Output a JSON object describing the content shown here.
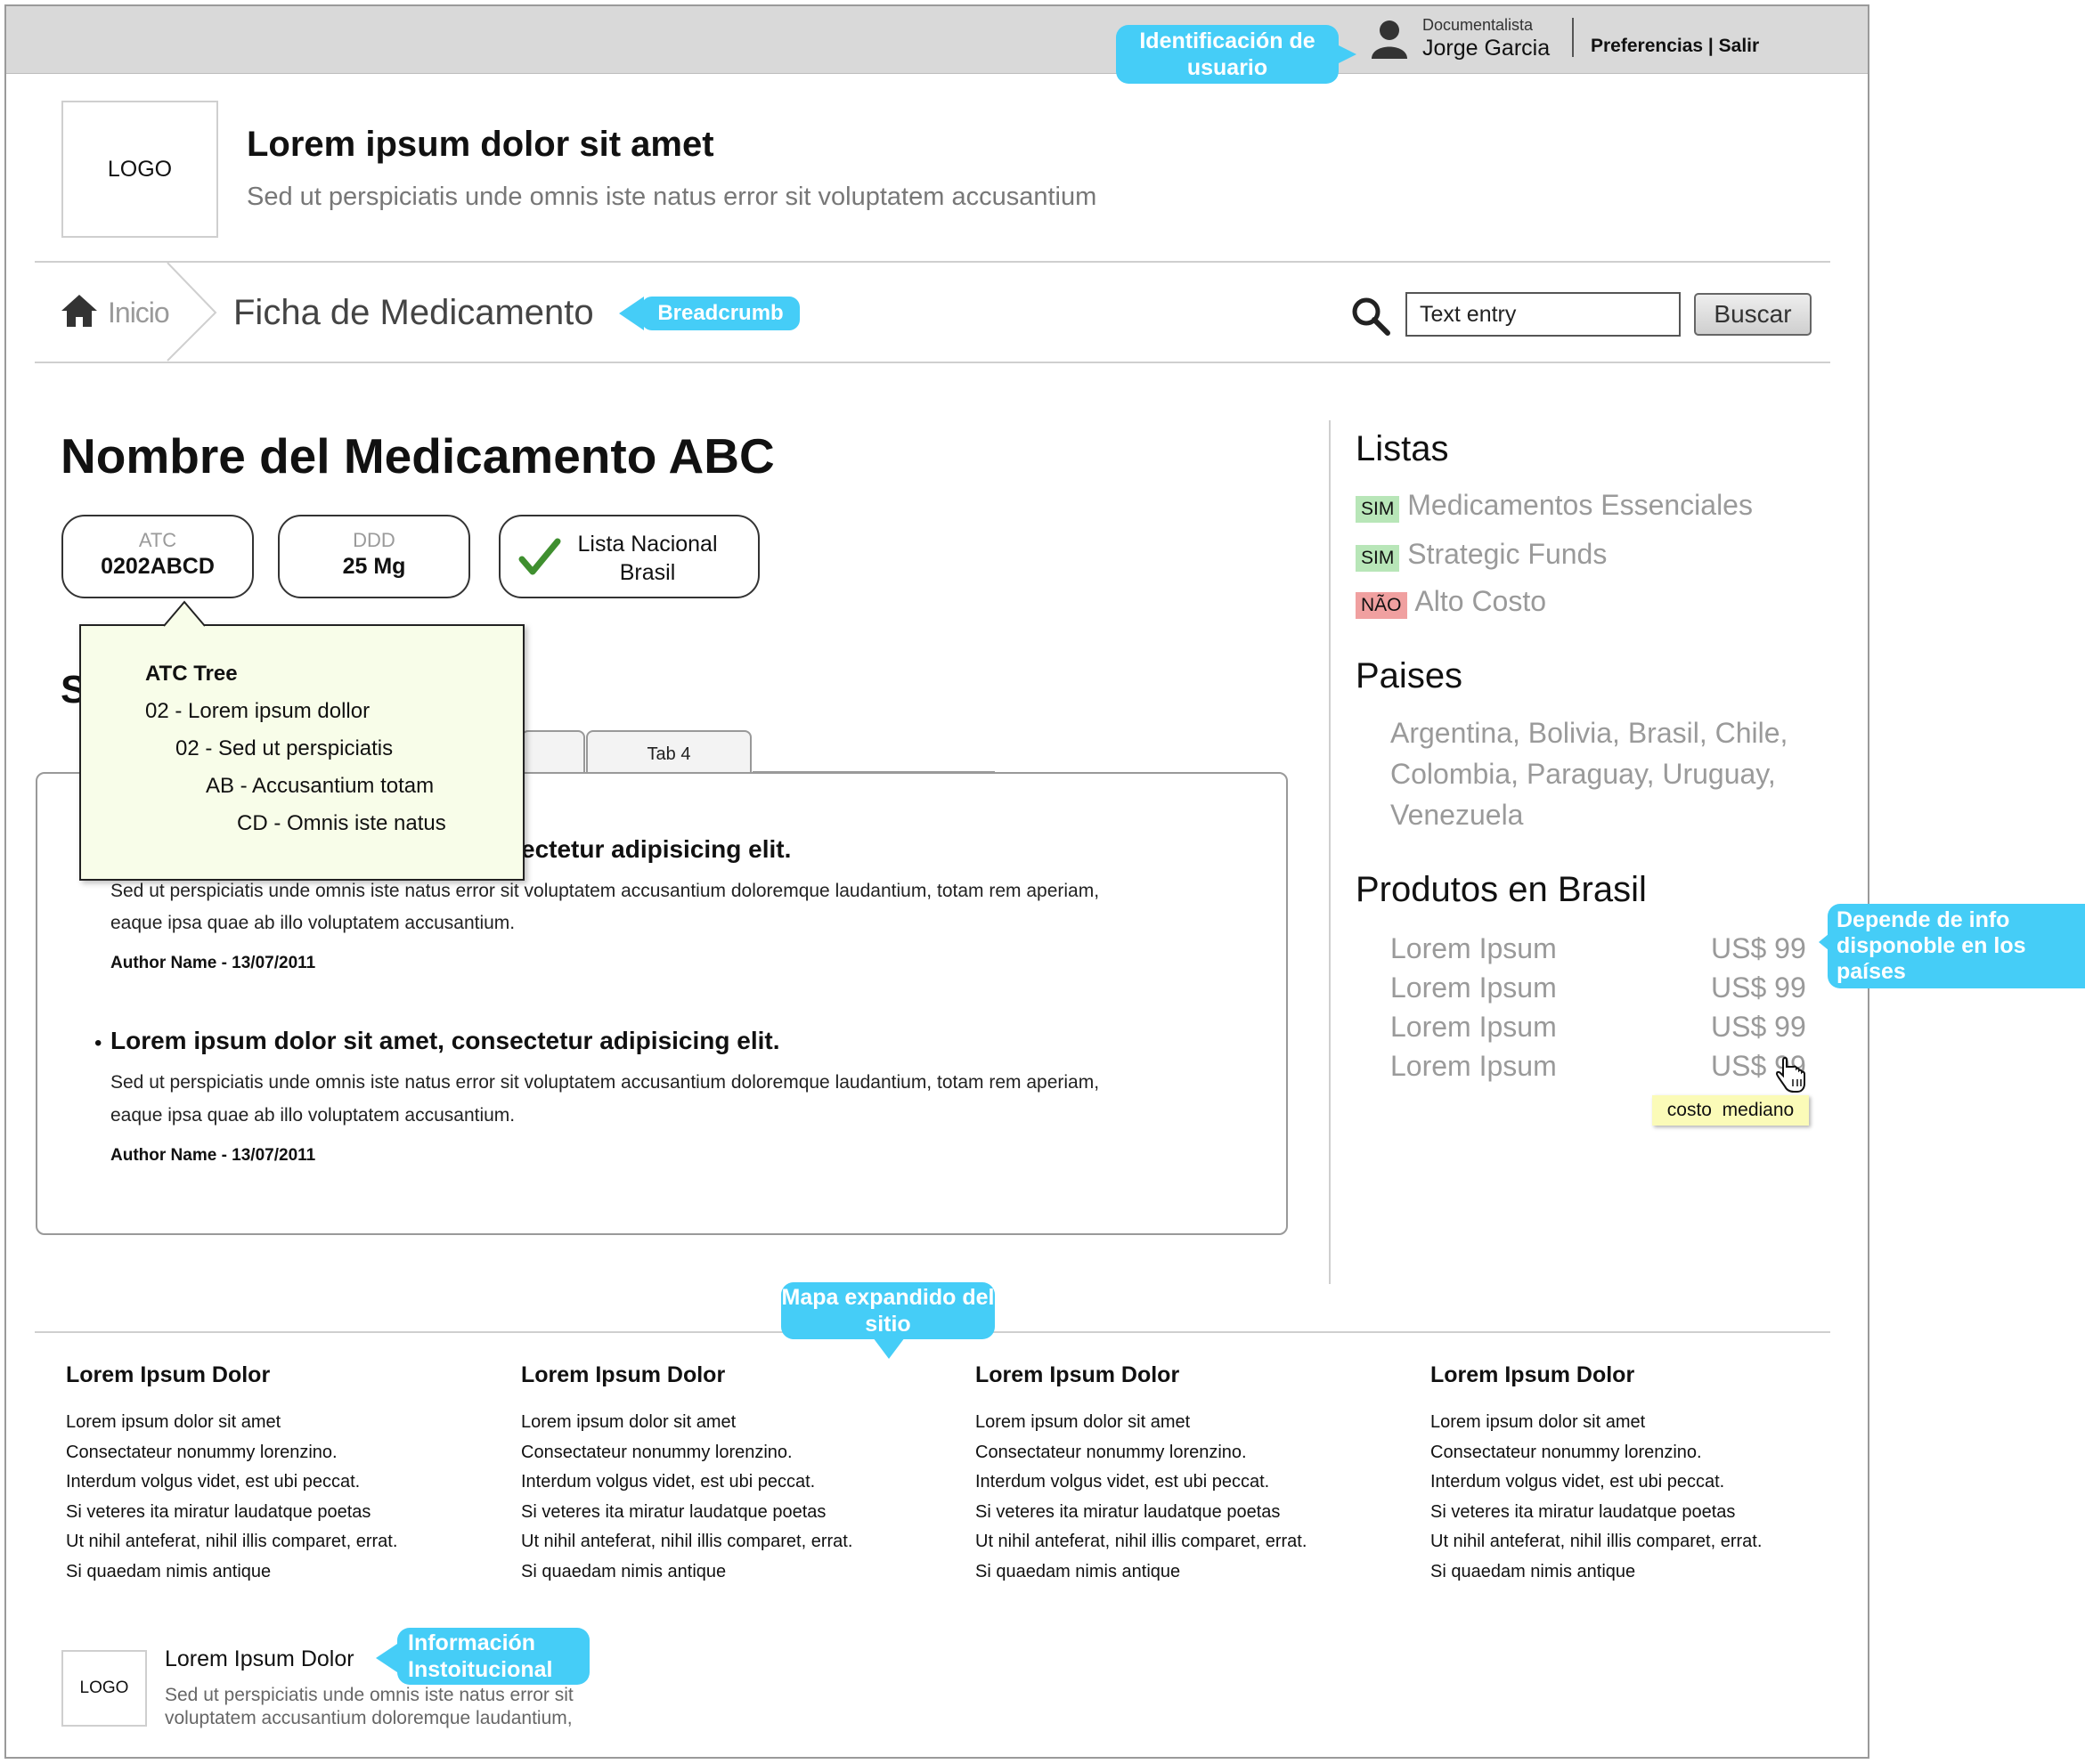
{
  "user": {
    "callout": "Identificación de usuario",
    "role": "Documentalista",
    "name": "Jorge Garcia",
    "links": "Preferencias | Salir"
  },
  "header": {
    "logo": "LOGO",
    "title": "Lorem ipsum dolor sit amet",
    "subtitle": "Sed ut perspiciatis unde omnis iste natus error sit voluptatem accusantium"
  },
  "nav": {
    "home": "Inicio",
    "current": "Ficha de Medicamento",
    "callout": "Breadcrumb",
    "search_value": "Text entry",
    "search_button": "Buscar"
  },
  "medicine": {
    "name": "Nombre del Medicamento ABC",
    "atc_label": "ATC",
    "atc_value": "0202ABCD",
    "ddd_label": "DDD",
    "ddd_value": "25 Mg",
    "lista_line1": "Lista Nacional",
    "lista_line2": "Brasil",
    "section_heading_partial": "S"
  },
  "atc_tree": {
    "title": "ATC Tree",
    "items": [
      "02 - Lorem ipsum dollor",
      "02 - Sed ut perspiciatis",
      "AB - Accusantium totam",
      "CD - Omnis iste natus"
    ]
  },
  "tabs": {
    "tab4": "Tab 4"
  },
  "articles": [
    {
      "title_partial": "ectetur adipisicing elit.",
      "body1": "Sed ut perspiciatis unde omnis iste natus error sit voluptatem accusantium doloremque laudantium, totam rem aperiam,",
      "body2": "eaque ipsa quae ab illo voluptatem accusantium.",
      "author": "Author Name - 13/07/2011"
    },
    {
      "title": "Lorem ipsum dolor sit amet, consectetur adipisicing elit.",
      "body1": "Sed ut perspiciatis unde omnis iste natus error sit voluptatem accusantium doloremque laudantium, totam rem aperiam,",
      "body2": "eaque ipsa quae ab illo voluptatem accusantium.",
      "author": "Author Name - 13/07/2011"
    }
  ],
  "sidebar": {
    "listas_title": "Listas",
    "listas": [
      {
        "tag": "SIM",
        "label": "Medicamentos Essenciales"
      },
      {
        "tag": "SIM",
        "label": "Strategic Funds"
      },
      {
        "tag": "NÃO",
        "label": "Alto Costo"
      }
    ],
    "paises_title": "Paises",
    "paises_lines": [
      "Argentina, Bolivia, Brasil, Chile,",
      "Colombia, Paraguay, Uruguay,",
      "Venezuela"
    ],
    "productos_title": "Produtos en Brasil",
    "productos": [
      {
        "name": "Lorem Ipsum",
        "price": "US$ 99"
      },
      {
        "name": "Lorem Ipsum",
        "price": "US$ 99"
      },
      {
        "name": "Lorem Ipsum",
        "price": "US$ 99"
      },
      {
        "name": "Lorem Ipsum",
        "price": "US$ 99"
      }
    ],
    "tooltip": "costo  mediano",
    "callout": "Depende de info disponoble en los países"
  },
  "sitemap": {
    "callout": "Mapa expandido del sitio",
    "columns": [
      {
        "title": "Lorem Ipsum Dolor",
        "lines": [
          "Lorem ipsum dolor sit amet",
          "Consectateur nonummy lorenzino.",
          "Interdum volgus videt, est ubi peccat.",
          "Si veteres ita miratur laudatque poetas",
          "Ut nihil anteferat, nihil illis comparet, errat.",
          "Si quaedam nimis antique"
        ]
      },
      {
        "title": "Lorem Ipsum Dolor",
        "lines": [
          "Lorem ipsum dolor sit amet",
          "Consectateur nonummy lorenzino.",
          "Interdum volgus videt, est ubi peccat.",
          "Si veteres ita miratur laudatque poetas",
          "Ut nihil anteferat, nihil illis comparet, errat.",
          "Si quaedam nimis antique"
        ]
      },
      {
        "title": "Lorem Ipsum Dolor",
        "lines": [
          "Lorem ipsum dolor sit amet",
          "Consectateur nonummy lorenzino.",
          "Interdum volgus videt, est ubi peccat.",
          "Si veteres ita miratur laudatque poetas",
          "Ut nihil anteferat, nihil illis comparet, errat.",
          "Si quaedam nimis antique"
        ]
      },
      {
        "title": "Lorem Ipsum Dolor",
        "lines": [
          "Lorem ipsum dolor sit amet",
          "Consectateur nonummy lorenzino.",
          "Interdum volgus videt, est ubi peccat.",
          "Si veteres ita miratur laudatque poetas",
          "Ut nihil anteferat, nihil illis comparet, errat.",
          "Si quaedam nimis antique"
        ]
      }
    ]
  },
  "footer": {
    "logo": "LOGO",
    "title": "Lorem Ipsum Dolor",
    "text1": "Sed ut perspiciatis unde omnis iste natus error sit",
    "text2": "voluptatem accusantium doloremque laudantium,",
    "callout": "Información Instoitucional"
  },
  "colors": {
    "callout": "#45cdf7",
    "topbar": "#d9d9d9",
    "tree_bg": "#f8fde9",
    "sim": "#b8e6b8",
    "nao": "#f0a0a0",
    "tooltip": "#fbfbb8"
  },
  "icons": [
    "user-icon",
    "home-icon",
    "search-icon",
    "check-icon",
    "hand-cursor-icon"
  ]
}
